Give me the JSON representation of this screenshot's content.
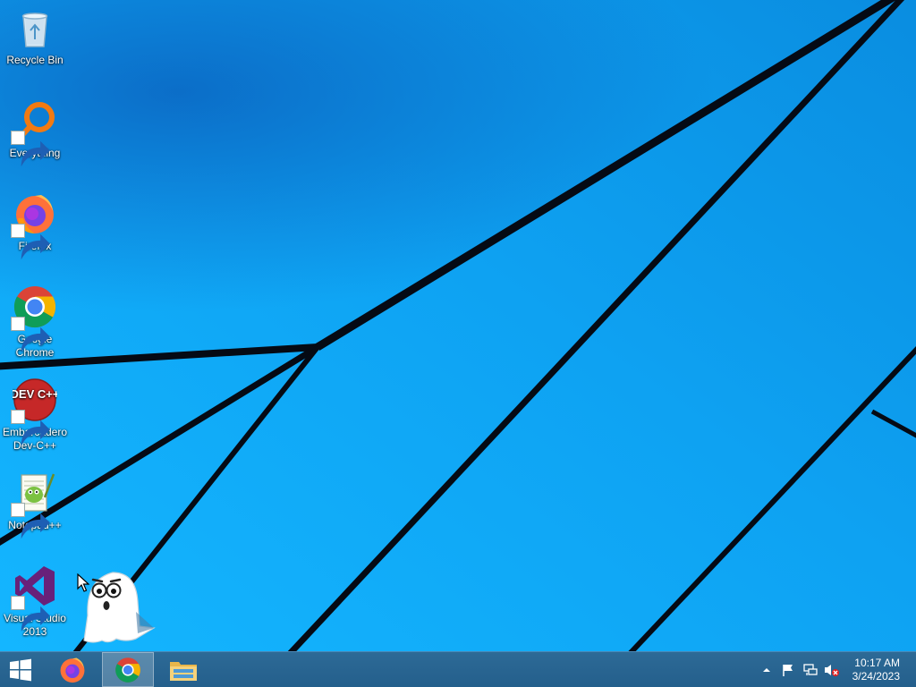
{
  "desktop": {
    "icons": [
      {
        "label": "Recycle Bin",
        "icon": "recycle-bin-icon",
        "shortcut": false
      },
      {
        "label": "Everything",
        "icon": "everything-search-icon",
        "shortcut": true
      },
      {
        "label": "Firefox",
        "icon": "firefox-icon",
        "shortcut": true
      },
      {
        "label": "Google Chrome",
        "icon": "chrome-icon",
        "shortcut": true
      },
      {
        "label": "Embarcadero Dev-C++",
        "icon": "devcpp-icon",
        "icon_text": "DEV C++",
        "shortcut": true
      },
      {
        "label": "Notepad++",
        "icon": "notepadpp-icon",
        "shortcut": true
      },
      {
        "label": "Visual Studio 2013",
        "icon": "visual-studio-icon",
        "shortcut": true
      }
    ],
    "overlay": {
      "icon": "ghost-mascot-icon"
    },
    "cursor": {
      "icon": "mouse-pointer-icon"
    }
  },
  "taskbar": {
    "start": {
      "icon": "windows-start-icon"
    },
    "pinned": [
      {
        "name": "Firefox",
        "icon": "firefox-icon",
        "active": false
      },
      {
        "name": "Google Chrome",
        "icon": "chrome-icon",
        "active": true
      },
      {
        "name": "File Explorer",
        "icon": "file-explorer-icon",
        "active": false
      }
    ],
    "tray": {
      "icons": [
        "show-hidden-icons-chevron-icon",
        "action-center-flag-icon",
        "network-icon",
        "volume-muted-icon"
      ],
      "time": "10:17 AM",
      "date": "3/24/2023"
    }
  },
  "colors": {
    "wallpaper": "#0aa0f0",
    "wallpaper_dark": "#0a6cc4",
    "taskbar": "#2a6792",
    "firefox_orange": "#ff7139",
    "chrome_red": "#db4437",
    "chrome_green": "#0f9d58",
    "chrome_yellow": "#f4b400",
    "chrome_blue": "#4285f4",
    "visual_studio_purple": "#68217a",
    "devcpp_red": "#d32f2f"
  }
}
